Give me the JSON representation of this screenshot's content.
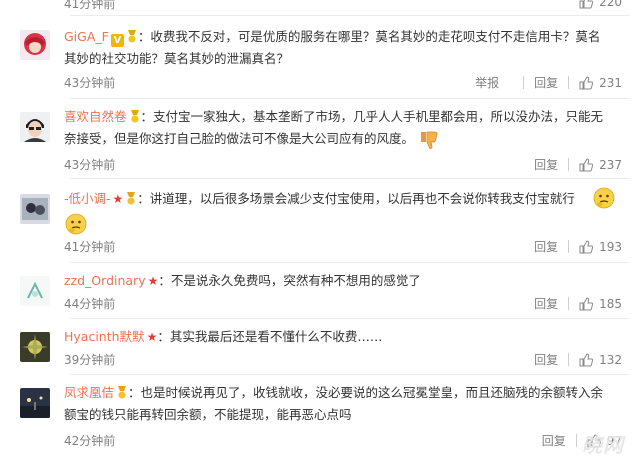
{
  "comments": [
    {
      "time": "41分钟前",
      "likes": "220"
    },
    {
      "user": "GiGA_F",
      "text": "：收费我不反对，可是优质的服务在哪里？莫名其妙的走花呗支付不走信用卡？莫名其妙的社交功能？莫名其妙的泄漏真名？",
      "time": "43分钟前",
      "report": "举报",
      "reply": "回复",
      "likes": "231"
    },
    {
      "user": "喜欢自然卷",
      "text": "：支付宝一家独大，基本垄断了市场，几乎人人手机里都会用，所以没办法，只能无奈接受，但是你这打自己脸的做法可不像是大公司应有的风度。",
      "time": "43分钟前",
      "reply": "回复",
      "likes": "237"
    },
    {
      "user": "-低小调-",
      "text": "：讲道理，以后很多场景会减少支付宝使用，以后再也不会说你转我支付宝就行",
      "time": "41分钟前",
      "reply": "回复",
      "likes": "193"
    },
    {
      "user": "zzd_Ordinary",
      "text": "：不是说永久免费吗，突然有种不想用的感觉了",
      "time": "44分钟前",
      "reply": "回复",
      "likes": "185"
    },
    {
      "user": "Hyacinth默默",
      "text": "：其实我最后还是看不懂什么不收费……",
      "time": "39分钟前",
      "reply": "回复",
      "likes": "132"
    },
    {
      "user": "凤求凰佶",
      "text": "：也是时候说再见了，收钱就收，没必要说的这么冠冕堂皇，而且还脑残的余额转入余额宝的钱只能再转回余额，不能提现，能再恶心点吗",
      "time": "42分钟前",
      "reply": "回复",
      "likes": "97"
    }
  ],
  "watermark": "晓网",
  "colors": {
    "username": "#eb7350",
    "meta": "#808080",
    "star": "#e43b2c",
    "vip": "#f4b400"
  }
}
